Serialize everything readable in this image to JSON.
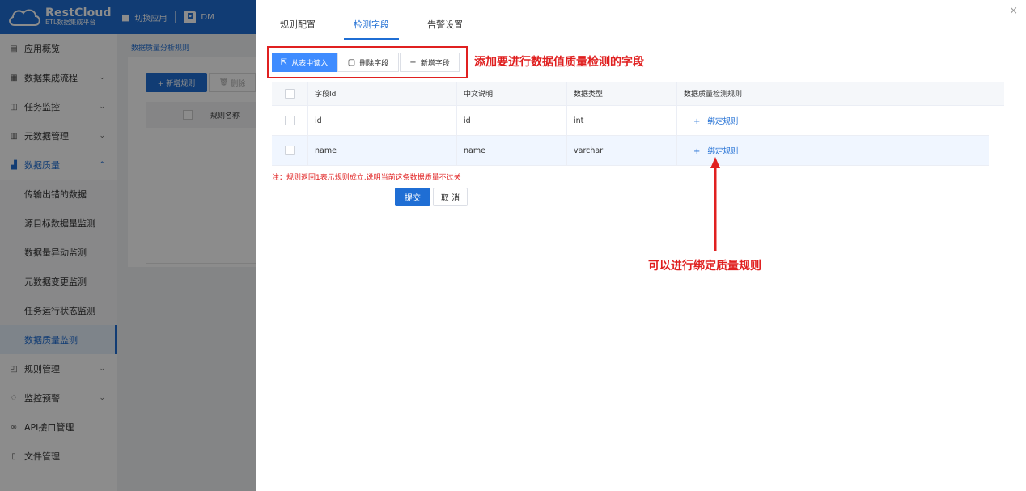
{
  "header": {
    "logo_name": "RestCloud",
    "logo_sub": "ETL数据集成平台",
    "switch_app": "切换应用",
    "app_name": "DM"
  },
  "sidebar": {
    "items": [
      {
        "label": "应用概览",
        "icon": "overview-icon",
        "glyph": "▤"
      },
      {
        "label": "数据集成流程",
        "icon": "grid-icon",
        "glyph": "▦",
        "expandable": true
      },
      {
        "label": "任务监控",
        "icon": "monitor-icon",
        "glyph": "◫",
        "expandable": true
      },
      {
        "label": "元数据管理",
        "icon": "list-icon",
        "glyph": "▥",
        "expandable": true
      },
      {
        "label": "数据质量",
        "icon": "chart-icon",
        "glyph": "▟",
        "expandable": true,
        "expanded": true
      },
      {
        "label": "传输出错的数据",
        "sub": true
      },
      {
        "label": "源目标数据量监测",
        "sub": true
      },
      {
        "label": "数据量异动监测",
        "sub": true
      },
      {
        "label": "元数据变更监测",
        "sub": true
      },
      {
        "label": "任务运行状态监测",
        "sub": true
      },
      {
        "label": "数据质量监测",
        "sub": true,
        "selected": true
      },
      {
        "label": "规则管理",
        "icon": "rule-icon",
        "glyph": "◰",
        "expandable": true
      },
      {
        "label": "监控预警",
        "icon": "alarm-icon",
        "glyph": "♢",
        "expandable": true
      },
      {
        "label": "API接口管理",
        "icon": "link-icon",
        "glyph": "∞"
      },
      {
        "label": "文件管理",
        "icon": "file-icon",
        "glyph": "▯"
      }
    ]
  },
  "background": {
    "breadcrumb": "数据质量分析规则",
    "add_rule": "+ 新增规则",
    "delete_rule": "删除",
    "col_rule_name": "规则名称"
  },
  "drawer": {
    "tabs": [
      {
        "label": "规则配置"
      },
      {
        "label": "检测字段",
        "active": true
      },
      {
        "label": "告警设置"
      }
    ],
    "close": "×",
    "toolbar": {
      "read_from_table": "从表中读入",
      "delete_field": "删除字段",
      "add_field": "新增字段"
    },
    "annotation_top": "添加要进行数据值质量检测的字段",
    "table": {
      "columns": [
        "字段Id",
        "中文说明",
        "数据类型",
        "数据质量检测规则"
      ],
      "rows": [
        {
          "field_id": "id",
          "desc": "id",
          "type": "int",
          "rule_link": "绑定规则"
        },
        {
          "field_id": "name",
          "desc": "name",
          "type": "varchar",
          "rule_link": "绑定规则"
        }
      ]
    },
    "note": "注：规则返回1表示规则成立,说明当前这条数据质量不过关",
    "submit": "提交",
    "cancel": "取 消",
    "annotation_bottom": "可以进行绑定质量规则"
  },
  "colors": {
    "brand": "#1f6ed4",
    "annotation": "#e02020"
  }
}
